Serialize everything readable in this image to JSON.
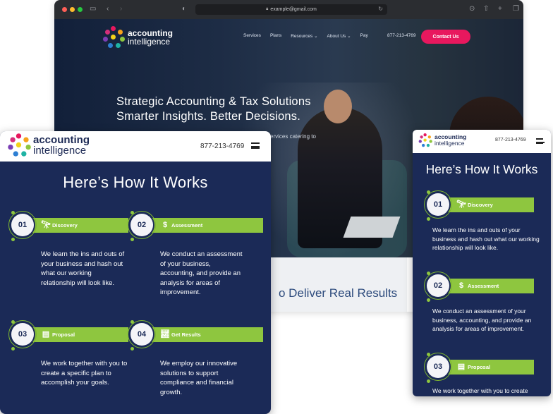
{
  "desktop": {
    "url": "example@gmail.com",
    "nav": {
      "logo_line1": "accounting",
      "logo_line2": "intelligence",
      "menu": [
        "Services",
        "Plans",
        "Resources ⌄",
        "About Us ⌄",
        "Pay"
      ],
      "phone": "877-213-4769",
      "contact_label": "Contact Us"
    },
    "hero": {
      "headline_line1": "Strategic Accounting & Tax Solutions",
      "headline_line2": "Smarter Insights. Better Decisions.",
      "sub_fragment": "ervices catering to"
    },
    "band_heading_fragment": "o Deliver Real Results"
  },
  "tablet": {
    "logo_line1": "accounting",
    "logo_line2": "intelligence",
    "phone": "877-213-4769",
    "title": "Here’s How It Works",
    "steps": [
      {
        "num": "01",
        "label": "Discovery",
        "icon": "telescope-icon",
        "text": "We learn the ins and outs of your business and hash out what our working relationship will look like."
      },
      {
        "num": "02",
        "label": "Assessment",
        "icon": "money-icon",
        "text": "We conduct an assessment of your business, accounting, and provide an analysis for areas of improvement."
      },
      {
        "num": "03",
        "label": "Proposal",
        "icon": "clipboard-icon",
        "text": "We work together with you to create a specific plan to accomplish your goals."
      },
      {
        "num": "04",
        "label": "Get Results",
        "icon": "growth-chart-icon",
        "text": "We employ our innovative solutions to support compliance and financial growth."
      }
    ]
  },
  "mobile": {
    "logo_line1": "accounting",
    "logo_line2": "intelligence",
    "phone": "877-213-4769",
    "title": "Here’s How It Works",
    "steps": [
      {
        "num": "01",
        "label": "Discovery",
        "icon": "telescope-icon",
        "text": "We learn the ins and outs of your business and hash out what our working relationship will look like."
      },
      {
        "num": "02",
        "label": "Assessment",
        "icon": "money-icon",
        "text": "We conduct an assessment of your business,  accounting, and provide an analysis for areas of improvement."
      },
      {
        "num": "03",
        "label": "Proposal",
        "icon": "clipboard-icon",
        "text": "We work together with you to create"
      }
    ]
  },
  "colors": {
    "navy": "#1b2a57",
    "green": "#8ec63f",
    "pink": "#e8185e",
    "desktop_bg": "#0f1a30"
  }
}
